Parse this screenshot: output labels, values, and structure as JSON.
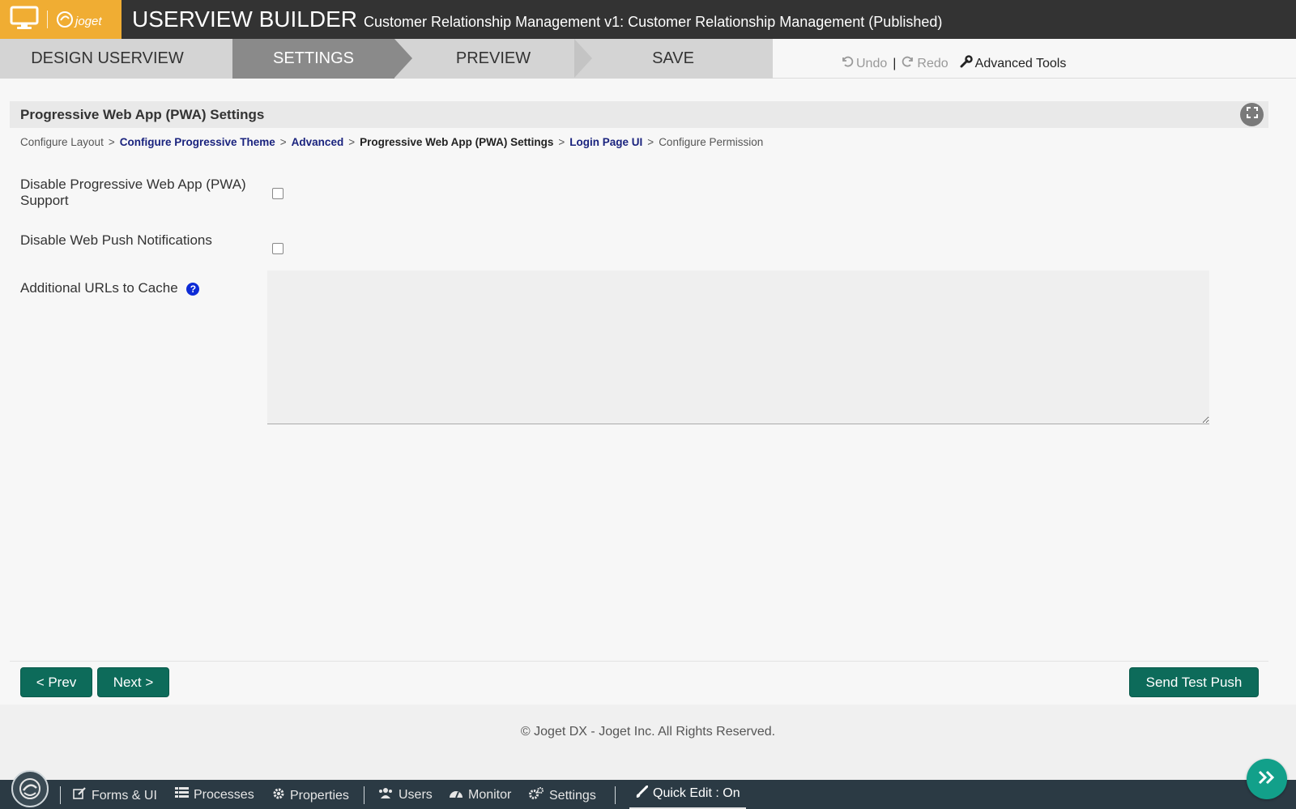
{
  "header": {
    "logo_text": "joget",
    "title": "USERVIEW BUILDER",
    "subtitle": "Customer Relationship Management v1: Customer Relationship Management (Published)"
  },
  "steps": [
    {
      "label": "DESIGN USERVIEW",
      "active": false
    },
    {
      "label": "SETTINGS",
      "active": true
    },
    {
      "label": "PREVIEW",
      "active": false
    },
    {
      "label": "SAVE",
      "active": false
    }
  ],
  "toolbar": {
    "undo": "Undo",
    "separator": "|",
    "redo": "Redo",
    "advanced_tools": "Advanced Tools"
  },
  "panel": {
    "title": "Progressive Web App (PWA) Settings"
  },
  "breadcrumb": [
    {
      "label": "Configure Layout",
      "kind": "plain"
    },
    {
      "label": "Configure Progressive Theme",
      "kind": "link"
    },
    {
      "label": "Advanced",
      "kind": "link"
    },
    {
      "label": "Progressive Web App (PWA) Settings",
      "kind": "current"
    },
    {
      "label": "Login Page UI",
      "kind": "link"
    },
    {
      "label": "Configure Permission",
      "kind": "plain"
    }
  ],
  "breadcrumb_separator": ">",
  "fields": {
    "disable_pwa_label_line1": "Disable Progressive Web App (PWA)",
    "disable_pwa_label_line2": "Support",
    "disable_pwa_checked": false,
    "disable_push_label": "Disable Web Push Notifications",
    "disable_push_checked": false,
    "urls_label": "Additional URLs to Cache",
    "urls_value": ""
  },
  "buttons": {
    "prev": "< Prev",
    "next": "Next >",
    "send_test_push": "Send Test Push"
  },
  "footer": {
    "copyright": "© Joget DX - Joget Inc. All Rights Reserved."
  },
  "adminbar": {
    "forms_ui": "Forms & UI",
    "processes": "Processes",
    "properties": "Properties",
    "users": "Users",
    "monitor": "Monitor",
    "settings": "Settings",
    "quick_edit": "Quick Edit : On"
  },
  "colors": {
    "brand_orange": "#f0ad33",
    "header_dark": "#333333",
    "step_active": "#8a8a8a",
    "primary_button": "#0d6b5a",
    "link_navy": "#1a237e",
    "help_blue": "#0d2bd6",
    "adminbar": "#2b3a44",
    "fab": "#12a08a"
  }
}
